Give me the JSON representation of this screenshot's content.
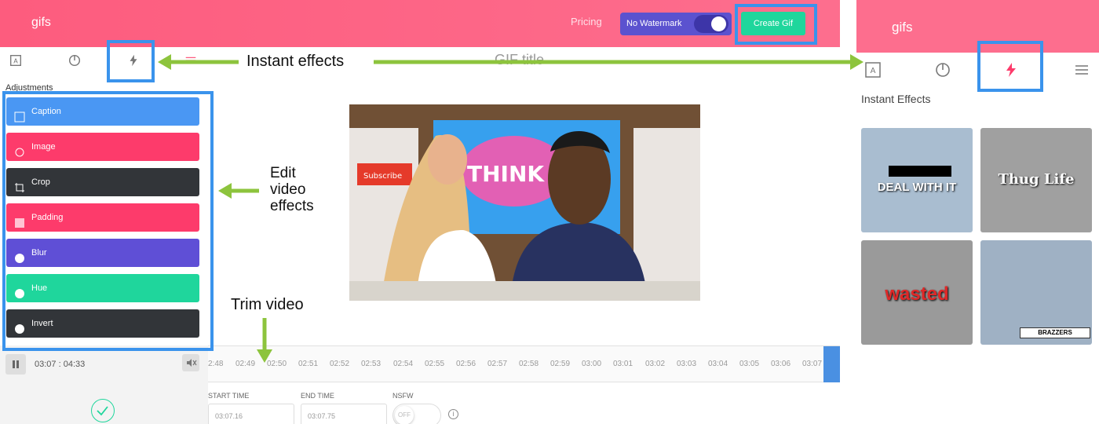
{
  "editor": {
    "brand": "gifs",
    "pricing": "Pricing",
    "watermark_label": "No Watermark",
    "create_gif": "Create Gif",
    "gif_title": "GIF title",
    "adjustments_label": "Adjustments",
    "adjustments": [
      {
        "label": "Caption",
        "color": "#4a97f3",
        "icon": "caption-icon"
      },
      {
        "label": "Image",
        "color": "#fd3b6b",
        "icon": "image-icon"
      },
      {
        "label": "Crop",
        "color": "#323539",
        "icon": "crop-icon"
      },
      {
        "label": "Padding",
        "color": "#fd3b6b",
        "icon": "padding-icon"
      },
      {
        "label": "Blur",
        "color": "#5f4fd6",
        "icon": "palette-icon"
      },
      {
        "label": "Hue",
        "color": "#1fd69c",
        "icon": "palette-icon"
      },
      {
        "label": "Invert",
        "color": "#323539",
        "icon": "palette-icon"
      }
    ],
    "time_current": "03:07",
    "time_total": "04:33",
    "timeline_ticks": [
      "2:48",
      "02:49",
      "02:50",
      "02:51",
      "02:52",
      "02:53",
      "02:54",
      "02:55",
      "02:56",
      "02:57",
      "02:58",
      "02:59",
      "03:00",
      "03:01",
      "03:02",
      "03:03",
      "03:04",
      "03:05",
      "03:06",
      "03:07"
    ],
    "start_time_label": "START TIME",
    "start_time_value": "03:07.16",
    "end_time_label": "END TIME",
    "end_time_value": "03:07.75",
    "nsfw_label": "NSFW",
    "nsfw_value": "OFF",
    "info_symbol": "i",
    "preview_words": [
      "THINK TA",
      "Subscribe"
    ]
  },
  "zoom": {
    "brand": "gifs",
    "effects_label": "Instant Effects",
    "effects": [
      "DEAL WITH IT",
      "Thug Life",
      "wasted",
      "BRAZZERS"
    ]
  },
  "annotations": {
    "instant_effects": "Instant effects",
    "edit_effects": "Edit\nvideo\neffects",
    "trim_video": "Trim video"
  },
  "colors": {
    "accent": "#fd5c7e",
    "green": "#1fd69c",
    "highlight": "#3a93ec",
    "arrow": "#8dc43d"
  }
}
